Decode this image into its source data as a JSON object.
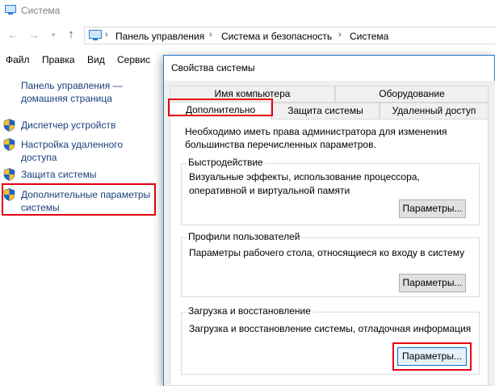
{
  "window": {
    "title": "Система"
  },
  "address": {
    "crumbs": [
      "Панель управления",
      "Система и безопасность",
      "Система"
    ]
  },
  "menu": {
    "items": [
      "Файл",
      "Правка",
      "Вид",
      "Сервис"
    ]
  },
  "sidebar": {
    "home": "Панель управления — домашняя страница",
    "items": [
      "Диспетчер устройств",
      "Настройка удаленного доступа",
      "Защита системы",
      "Дополнительные параметры системы"
    ]
  },
  "dialog": {
    "title": "Свойства системы",
    "tabs_top": [
      "Имя компьютера",
      "Оборудование"
    ],
    "tabs_bottom": [
      "Дополнительно",
      "Защита системы",
      "Удаленный доступ"
    ],
    "selected_tab": "Дополнительно",
    "admin_note": "Необходимо иметь права администратора для изменения большинства перечисленных параметров.",
    "groups": [
      {
        "title": "Быстродействие",
        "text": "Визуальные эффекты, использование процессора, оперативной и виртуальной памяти",
        "button": "Параметры..."
      },
      {
        "title": "Профили пользователей",
        "text": "Параметры рабочего стола, относящиеся ко входу в систему",
        "button": "Параметры..."
      },
      {
        "title": "Загрузка и восстановление",
        "text": "Загрузка и восстановление системы, отладочная информация",
        "button": "Параметры..."
      }
    ]
  },
  "colors": {
    "highlight": "#e3000f",
    "link": "#1a3f7a",
    "dialog_border": "#2b7bd4"
  }
}
